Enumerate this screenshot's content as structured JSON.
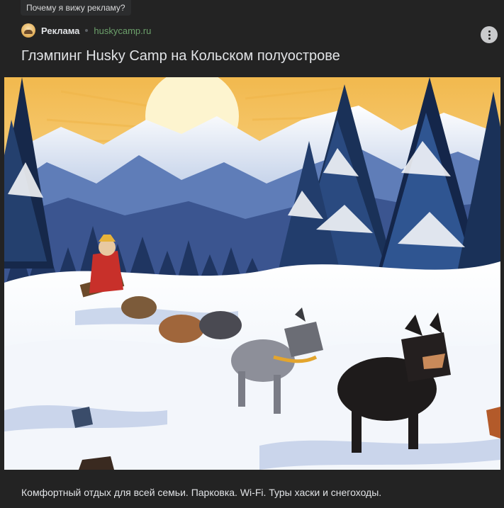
{
  "why_ad": "Почему я вижу рекламу?",
  "advertiser": {
    "label": "Реклама",
    "domain": "huskycamp.ru",
    "avatar_icon": "husky-avatar-icon"
  },
  "post": {
    "title": "Глэмпинг Husky Camp на Кольском полуострове",
    "caption": "Комфортный отдых для всей семьи. Парковка. Wi-Fi. Туры хаски и снегоходы.",
    "image_alt": "Упряжка хаски на фоне заснеженных гор и елей"
  },
  "colors": {
    "background": "#232323",
    "domain_link": "#6ca06b",
    "text": "#e1e3e6"
  },
  "icons": {
    "more": "more-vertical-icon"
  }
}
